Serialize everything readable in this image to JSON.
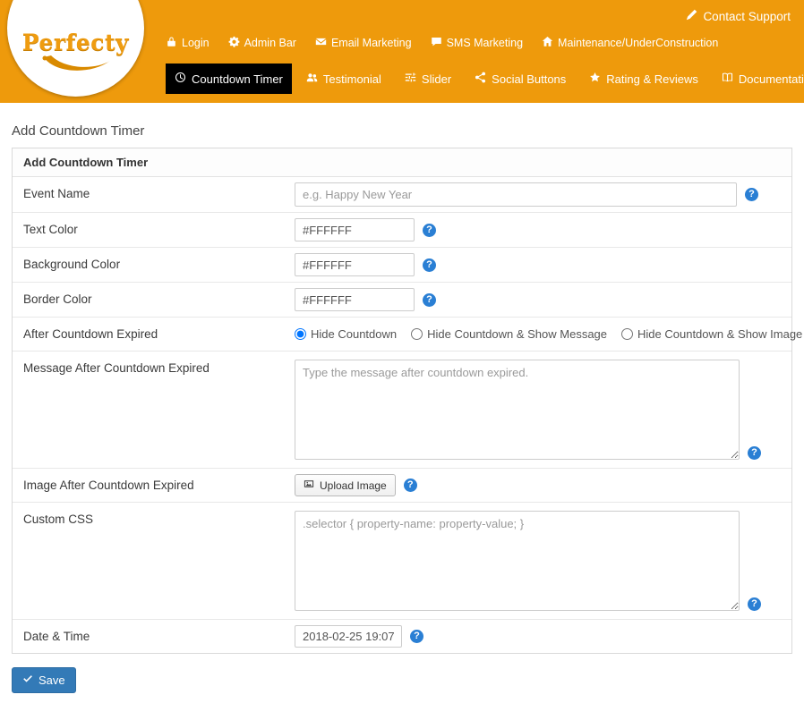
{
  "colors": {
    "header_orange": "#ee9a0c",
    "active_tab_black": "#000000",
    "accent_blue": "#337ab7",
    "help_icon_blue": "#2a7fd4"
  },
  "icons": {
    "question_mark": "?",
    "contact_support": "pencil-icon",
    "login": "lock-icon",
    "admin_bar": "gear-icon",
    "email_marketing": "envelope-icon",
    "sms_marketing": "comment-icon",
    "maintenance": "home-icon",
    "countdown_timer": "clock-icon",
    "testimonial": "users-icon",
    "slider": "sliders-icon",
    "social_buttons": "share-icon",
    "rating_reviews": "star-icon",
    "documentation": "book-icon",
    "upload": "image-icon",
    "save": "check-icon"
  },
  "header": {
    "contact_support": "Contact Support",
    "logo_text": "Perfecty",
    "nav_primary": [
      {
        "label": "Login",
        "icon": "lock-icon"
      },
      {
        "label": "Admin Bar",
        "icon": "gear-icon"
      },
      {
        "label": "Email Marketing",
        "icon": "envelope-icon"
      },
      {
        "label": "SMS Marketing",
        "icon": "comment-icon"
      },
      {
        "label": "Maintenance/UnderConstruction",
        "icon": "home-icon"
      }
    ],
    "nav_secondary": [
      {
        "label": "Countdown Timer",
        "icon": "clock-icon",
        "active": true
      },
      {
        "label": "Testimonial",
        "icon": "users-icon",
        "active": false
      },
      {
        "label": "Slider",
        "icon": "sliders-icon",
        "active": false
      },
      {
        "label": "Social Buttons",
        "icon": "share-icon",
        "active": false
      },
      {
        "label": "Rating & Reviews",
        "icon": "star-icon",
        "active": false
      },
      {
        "label": "Documentation",
        "icon": "book-icon",
        "active": false
      }
    ]
  },
  "page": {
    "title": "Add Countdown Timer",
    "panel_title": "Add Countdown Timer"
  },
  "form": {
    "event_name": {
      "label": "Event Name",
      "placeholder": "e.g. Happy New Year",
      "value": ""
    },
    "text_color": {
      "label": "Text Color",
      "value": "#FFFFFF"
    },
    "background_color": {
      "label": "Background Color",
      "value": "#FFFFFF"
    },
    "border_color": {
      "label": "Border Color",
      "value": "#FFFFFF"
    },
    "after_countdown_expired": {
      "label": "After Countdown Expired",
      "options": [
        "Hide Countdown",
        "Hide Countdown & Show Message",
        "Hide Countdown & Show Image"
      ],
      "selected": "Hide Countdown"
    },
    "message": {
      "label": "Message After Countdown Expired",
      "placeholder": "Type the message after countdown expired.",
      "value": ""
    },
    "image": {
      "label": "Image After Countdown Expired",
      "button_label": "Upload Image"
    },
    "custom_css": {
      "label": "Custom CSS",
      "placeholder": ".selector { property-name: property-value; }",
      "value": ""
    },
    "date_time": {
      "label": "Date & Time",
      "value": "2018-02-25 19:07"
    }
  },
  "actions": {
    "save_label": "Save"
  }
}
